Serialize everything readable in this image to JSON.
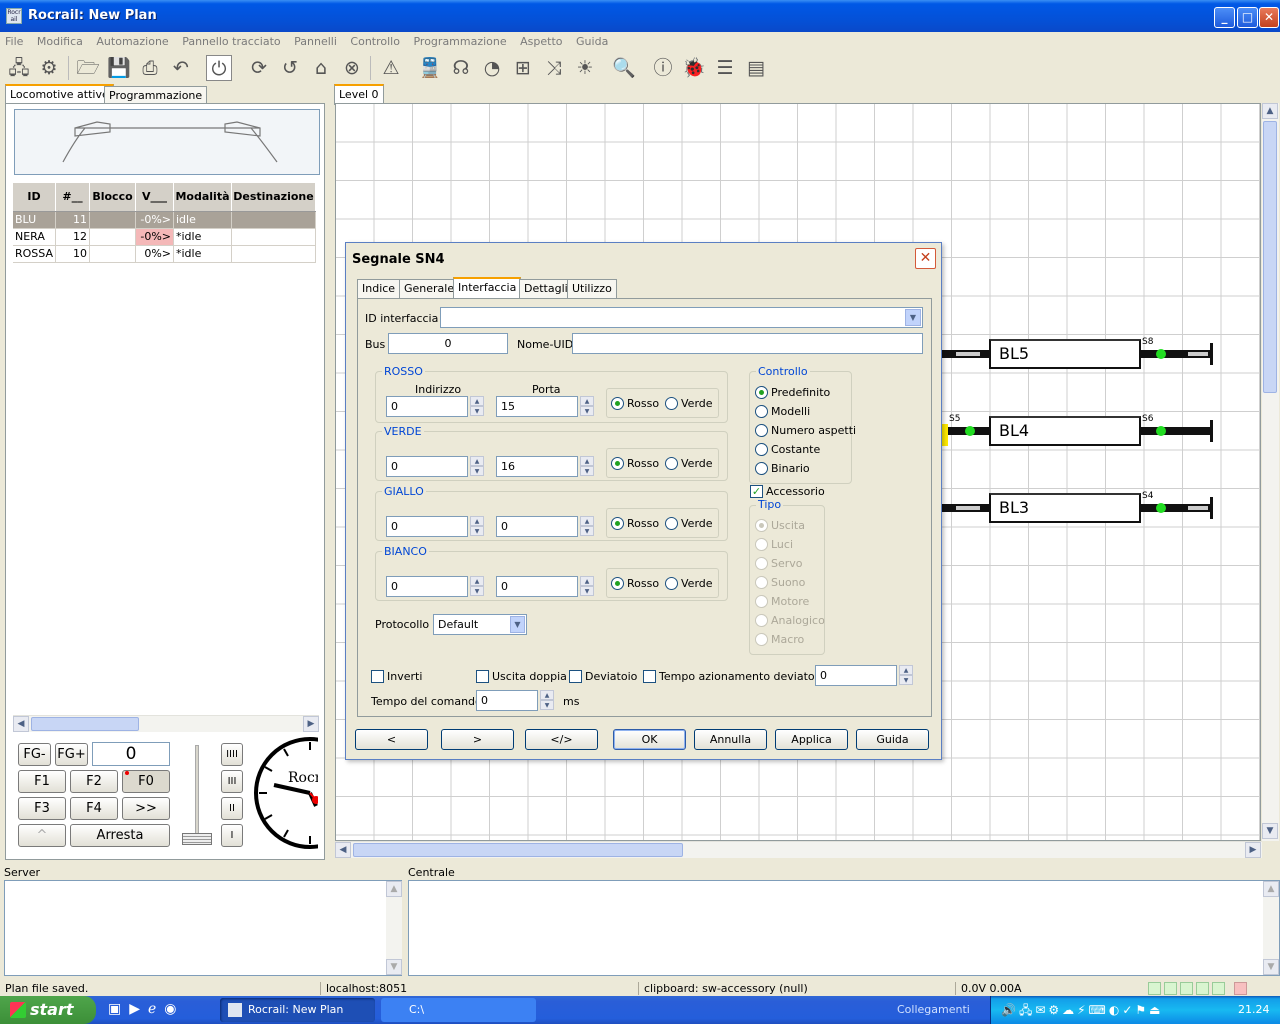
{
  "window": {
    "title": "Rocrail: New Plan"
  },
  "menu": [
    "File",
    "Modifica",
    "Automazione",
    "Pannello tracciato",
    "Pannelli",
    "Controllo",
    "Programmazione",
    "Aspetto",
    "Guida"
  ],
  "left_tabs": [
    "Locomotive attive",
    "Programmazione"
  ],
  "loco_table": {
    "columns": [
      "ID",
      "#__",
      "Blocco",
      "V___",
      "Modalità",
      "Destinazione"
    ],
    "rows": [
      {
        "id": "BLU",
        "num": "11",
        "block": "",
        "v": "-0%>",
        "mode": "idle",
        "dest": ""
      },
      {
        "id": "NERA",
        "num": "12",
        "block": "",
        "v": "-0%>",
        "mode": "*idle",
        "dest": ""
      },
      {
        "id": "ROSSA",
        "num": "10",
        "block": "",
        "v": "0%>",
        "mode": "*idle",
        "dest": ""
      }
    ]
  },
  "throttle": {
    "fg_minus": "FG-",
    "fg_plus": "FG+",
    "speed": "0",
    "f1": "F1",
    "f2": "F2",
    "f0": "F0",
    "f3": "F3",
    "f4": "F4",
    "more": ">>",
    "up": "^",
    "stop": "Arresta",
    "gears": [
      "IIII",
      "III",
      "II",
      "I"
    ],
    "clock_text": "Rocr"
  },
  "plan": {
    "tab": "Level 0",
    "blocks": [
      {
        "label": "BL5",
        "sensor": "S8"
      },
      {
        "label": "BL4",
        "sensor_left": "S5",
        "sensor": "S6"
      },
      {
        "label": "BL3",
        "sensor": "S4"
      }
    ]
  },
  "dialog": {
    "title": "Segnale SN4",
    "tabs": [
      "Indice",
      "Generale",
      "Interfaccia",
      "Dettagli",
      "Utilizzo"
    ],
    "iid_label": "ID interfaccia",
    "iid_value": "",
    "bus_label": "Bus",
    "bus_value": "0",
    "uid_label": "Nome-UID",
    "uid_value": "",
    "col_address": "Indirizzo",
    "col_port": "Porta",
    "groups": [
      {
        "name": "ROSSO",
        "address": "0",
        "port": "15",
        "opt1": "Rosso",
        "opt2": "Verde"
      },
      {
        "name": "VERDE",
        "address": "0",
        "port": "16",
        "opt1": "Rosso",
        "opt2": "Verde"
      },
      {
        "name": "GIALLO",
        "address": "0",
        "port": "0",
        "opt1": "Rosso",
        "opt2": "Verde"
      },
      {
        "name": "BIANCO",
        "address": "0",
        "port": "0",
        "opt1": "Rosso",
        "opt2": "Verde"
      }
    ],
    "control": {
      "label": "Controllo",
      "options": [
        "Predefinito",
        "Modelli",
        "Numero aspetti",
        "Costante",
        "Binario"
      ]
    },
    "accessory_label": "Accessorio",
    "type": {
      "label": "Tipo",
      "options": [
        "Uscita",
        "Luci",
        "Servo",
        "Suono",
        "Motore",
        "Analogico",
        "Macro"
      ]
    },
    "protocol_label": "Protocollo",
    "protocol_value": "Default",
    "invert_label": "Inverti",
    "double_out_label": "Uscita doppia",
    "switch_label": "Deviatoio",
    "switch_time_label": "Tempo azionamento deviatoio",
    "switch_time_value": "0",
    "cmd_time_label": "Tempo del comando",
    "cmd_time_value": "0",
    "cmd_time_unit": "ms",
    "buttons": {
      "prev": "<",
      "next": ">",
      "xml": "</>",
      "ok": "OK",
      "cancel": "Annulla",
      "apply": "Applica",
      "help": "Guida"
    }
  },
  "bottom": {
    "server_label": "Server",
    "central_label": "Centrale"
  },
  "status": {
    "message": "Plan file saved.",
    "host": "localhost:8051",
    "clipboard": "clipboard: sw-accessory (null)",
    "power": "0.0V 0.00A"
  },
  "taskbar": {
    "start": "start",
    "item1": "Rocrail: New Plan",
    "item2": "C:\\",
    "links": "Collegamenti",
    "clock": "21.24"
  },
  "colors": {
    "accent": "#0058e6",
    "group_title": "#0046d5",
    "signal_green": "#22dd22",
    "speed_highlight": "#f4b8b8"
  }
}
